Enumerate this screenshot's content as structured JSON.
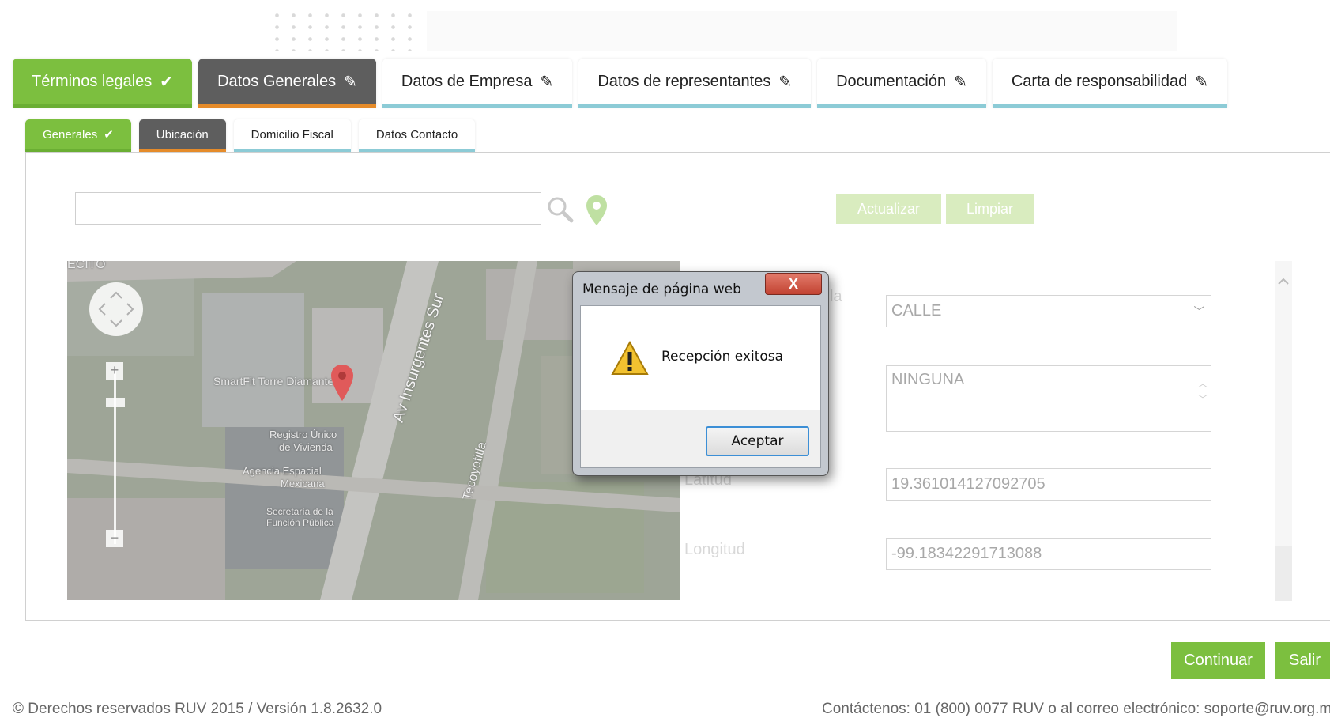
{
  "main_tabs": [
    {
      "label": "Términos legales",
      "icon": "check-icon",
      "icon_glyph": "✔",
      "state": "done"
    },
    {
      "label": "Datos Generales",
      "icon": "pencil-icon",
      "icon_glyph": "✎",
      "state": "active"
    },
    {
      "label": "Datos de Empresa",
      "icon": "pencil-icon",
      "icon_glyph": "✎",
      "state": "pending"
    },
    {
      "label": "Datos de representantes",
      "icon": "pencil-icon",
      "icon_glyph": "✎",
      "state": "pending"
    },
    {
      "label": "Documentación",
      "icon": "pencil-icon",
      "icon_glyph": "✎",
      "state": "pending"
    },
    {
      "label": "Carta de responsabilidad",
      "icon": "pencil-icon",
      "icon_glyph": "✎",
      "state": "pending"
    }
  ],
  "sub_tabs": [
    {
      "label": "Generales",
      "icon_glyph": "✔",
      "state": "done"
    },
    {
      "label": "Ubicación",
      "state": "active"
    },
    {
      "label": "Domicilio Fiscal",
      "state": "pending"
    },
    {
      "label": "Datos Contacto",
      "state": "pending"
    }
  ],
  "search": {
    "value": "",
    "placeholder": ""
  },
  "actions": {
    "update_label": "Actualizar",
    "clear_label": "Limpiar"
  },
  "map": {
    "labels": {
      "avenue": "Av Insurgentes Sur",
      "street": "Tecoyotitla",
      "poi_1": "SmartFit Torre Diamante",
      "poi_2a": "Registro Único",
      "poi_2b": "de Vivienda",
      "poi_3a": "Agencia Espacial",
      "poi_3b": "Mexicana",
      "poi_4a": "Secretaría de la",
      "poi_4b": "Función Pública",
      "corner": "ECITO"
    },
    "zoom_in": "+",
    "zoom_out": "−"
  },
  "form": {
    "street_type": "CALLE",
    "reference": "NINGUNA",
    "latitude_label": "Latitud",
    "latitude": "19.361014127092705",
    "longitude_label": "Longitud",
    "longitude": "-99.18342291713088",
    "partial_label": "la"
  },
  "buttons": {
    "continue_label": "Continuar",
    "exit_label": "Salir"
  },
  "footer": {
    "copyright": "© Derechos reservados RUV 2015 / Versión 1.8.2632.0",
    "contact": "Contáctenos: 01 (800) 0077 RUV o al correo electrónico: soporte@ruv.org.mx"
  },
  "dialog": {
    "title": "Mensaje de página web",
    "close_glyph": "X",
    "message": "Recepción exitosa",
    "ok_label": "Aceptar"
  },
  "colors": {
    "accent_green": "#7cbf3f",
    "active_tab": "#5e5e5e",
    "active_underline": "#e58b2a",
    "pending_underline": "#8ccbd6"
  }
}
